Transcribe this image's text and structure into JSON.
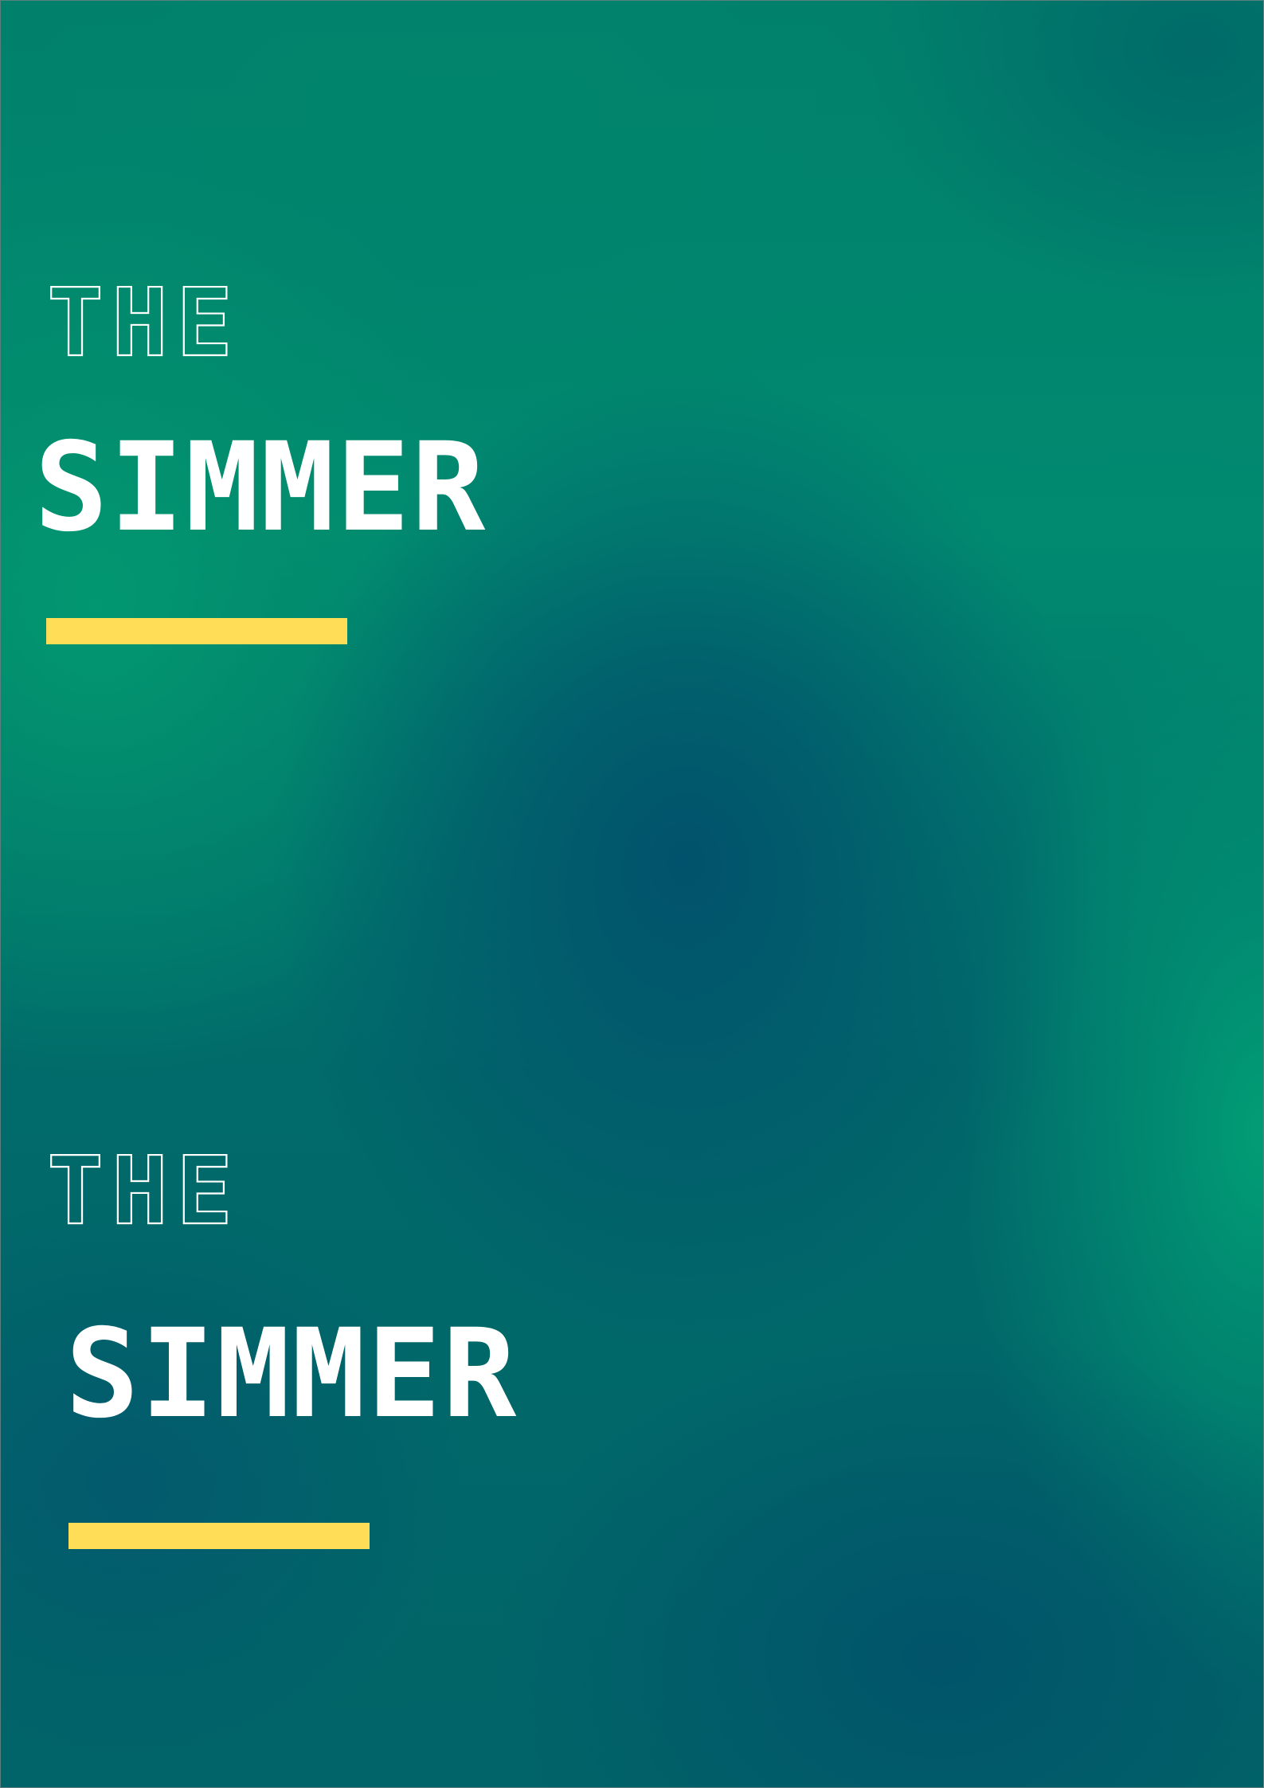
{
  "colors": {
    "text": "#ffffff",
    "accent": "#ffdd57",
    "background_green": "#019873",
    "background_blue": "#01546c"
  },
  "blocks": [
    {
      "the": "THE",
      "title": "SIMMER"
    },
    {
      "the": "THE",
      "title": "SIMMER"
    }
  ]
}
